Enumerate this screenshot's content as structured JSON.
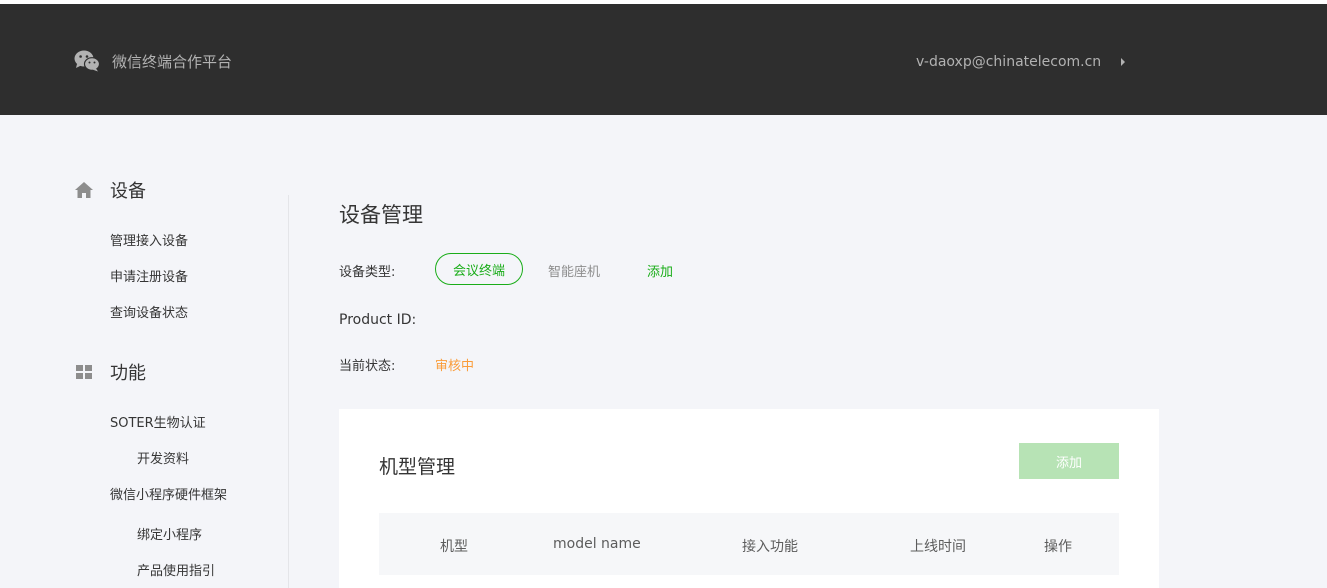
{
  "header": {
    "brand": "微信终端合作平台",
    "brand_icon": "wechat-icon",
    "account": "v-daoxp@chinatelecom.cn",
    "colors": {
      "background": "#2e2e2e",
      "text": "#b2b2b2"
    }
  },
  "sidebar": {
    "groups": [
      {
        "title": "设备",
        "icon": "home-icon",
        "items": [
          "管理接入设备",
          "申请注册设备",
          "查询设备状态"
        ]
      },
      {
        "title": "功能",
        "icon": "grid-icon",
        "items": [
          {
            "label": "SOTER生物认证",
            "level": 1
          },
          {
            "label": "开发资料",
            "level": 2
          },
          {
            "label": "微信小程序硬件框架",
            "level": 1
          },
          {
            "label": "绑定小程序",
            "level": 2
          },
          {
            "label": "产品使用指引",
            "level": 2
          }
        ]
      }
    ]
  },
  "main": {
    "title": "设备管理",
    "device_type": {
      "label": "设备类型:",
      "selected": "会议终端",
      "other": "智能座机",
      "add": "添加"
    },
    "product_id_label": "Product ID:",
    "status": {
      "label": "当前状态:",
      "value": "审核中"
    },
    "panel": {
      "title": "机型管理",
      "add_button": "添加",
      "columns": [
        "机型",
        "model name",
        "接入功能",
        "上线时间",
        "操作"
      ]
    }
  },
  "colors": {
    "accent": "#1aad19",
    "accent_disabled": "#b7e3b5",
    "status_pending": "#fa9d3b",
    "page_bg": "#f4f5f9"
  }
}
